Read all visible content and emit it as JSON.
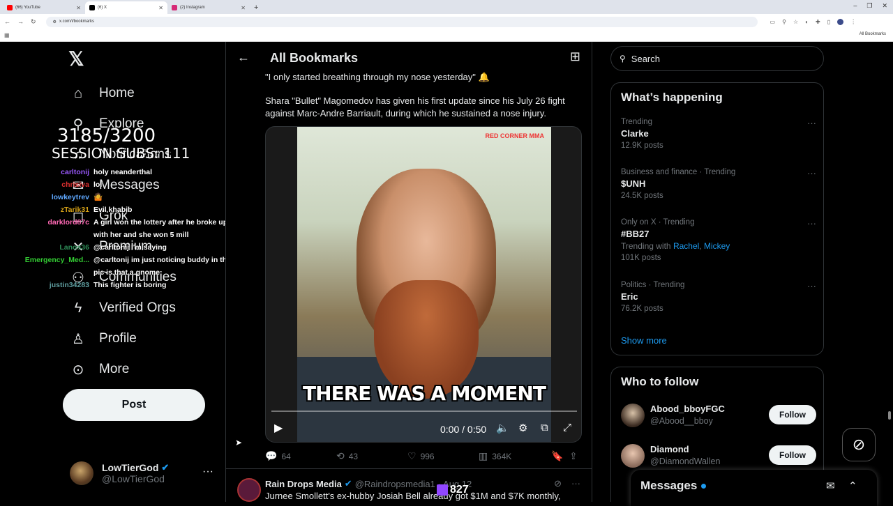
{
  "browser": {
    "tabs": [
      {
        "label": "(66) YouTube",
        "color": "#ff0000"
      },
      {
        "label": "(6) X",
        "color": "#000000"
      },
      {
        "label": "(2) Instagram",
        "color": "#d62976"
      }
    ],
    "url": "x.com/i/bookmarks",
    "all_bookmarks": "All Bookmarks"
  },
  "nav": {
    "items": [
      {
        "label": "Home",
        "icon": "home-icon",
        "glyph": "⌂"
      },
      {
        "label": "Explore",
        "icon": "search-icon",
        "glyph": "⚲"
      },
      {
        "label": "Notifications",
        "icon": "bell-icon",
        "glyph": "♫"
      },
      {
        "label": "Messages",
        "icon": "mail-icon",
        "glyph": "✉"
      },
      {
        "label": "Grok",
        "icon": "grok-icon",
        "glyph": "◻"
      },
      {
        "label": "Premium",
        "icon": "x-icon",
        "glyph": "✕"
      },
      {
        "label": "Communities",
        "icon": "people-icon",
        "glyph": "⚇"
      },
      {
        "label": "Verified Orgs",
        "icon": "lightning-icon",
        "glyph": "ϟ"
      },
      {
        "label": "Profile",
        "icon": "person-icon",
        "glyph": "♙"
      },
      {
        "label": "More",
        "icon": "more-circle-icon",
        "glyph": "⊙"
      }
    ],
    "post_label": "Post",
    "account": {
      "display_name": "LowTierGod",
      "handle": "@LowTierGod"
    }
  },
  "overlay": {
    "count": "3185/3200",
    "subs": "SESSION SUBS: 111",
    "chat": [
      {
        "user": "carltonij",
        "user_color": "#9b59ff",
        "msg": "holy neanderthal"
      },
      {
        "user": "chrisiva",
        "user_color": "#e03030",
        "msg": "lol"
      },
      {
        "user": "lowkeytrev",
        "user_color": "#5fa8ff",
        "msg": "🤷"
      },
      {
        "user": "zTarik31",
        "user_color": "#d4a017",
        "msg": "Evil khabib"
      },
      {
        "user": "darklord87c",
        "user_color": "#ff69b4",
        "msg": "A girl won the lottery after he broke up with her and she won 5 mill"
      },
      {
        "user": "Lanos36",
        "user_color": "#2e8b57",
        "msg": "@carltonij I'm saying"
      },
      {
        "user": "Emergency_Med...",
        "user_color": "#33cc33",
        "msg": "@carltonij im just noticing buddy in the pic is that a gnome"
      },
      {
        "user": "justin34283",
        "user_color": "#5f9ea0",
        "msg": "This fighter is boring"
      }
    ]
  },
  "main": {
    "title": "All Bookmarks",
    "tweet": {
      "quote": "\"I only started breathing through my nose yesterday\" 🔔",
      "body": "Shara \"Bullet\" Magomedov has given his first update since his July 26 fight against Marc-Andre Barriault, during which he sustained a nose injury.",
      "video": {
        "brand": "RED CORNER MMA",
        "caption": "THERE WAS A MOMENT",
        "time": "0:00 / 0:50",
        "progress": 0
      },
      "replies": "64",
      "reposts": "43",
      "likes": "996",
      "views": "364K"
    },
    "next_tweet": {
      "name": "Rain Drops Media",
      "handle": "@Raindropsmedia1",
      "date": "· Aug 12",
      "text": "Jurnee Smollett's ex-hubby Josiah Bell already got $1M and $7K monthly,",
      "viewer_count": "827"
    }
  },
  "sidebar": {
    "search_placeholder": "Search",
    "happening_title": "What’s happening",
    "trends": [
      {
        "context": "Trending",
        "topic": "Clarke",
        "count": "12.9K posts"
      },
      {
        "context": "Business and finance · Trending",
        "topic": "$UNH",
        "count": "24.5K posts"
      },
      {
        "context": "Only on X · Trending",
        "topic": "#BB27",
        "with_label": "Trending with",
        "with": [
          "Rachel",
          "Mickey"
        ],
        "count": "101K posts"
      },
      {
        "context": "Politics · Trending",
        "topic": "Eric",
        "count": "76.2K posts"
      }
    ],
    "show_more": "Show more",
    "follow_title": "Who to follow",
    "follow": [
      {
        "name": "Abood_bboyFGC",
        "handle": "@Abood__bboy",
        "btn": "Follow"
      },
      {
        "name": "Diamond",
        "handle": "@DiamondWallen",
        "btn": "Follow"
      }
    ],
    "messages_title": "Messages"
  }
}
